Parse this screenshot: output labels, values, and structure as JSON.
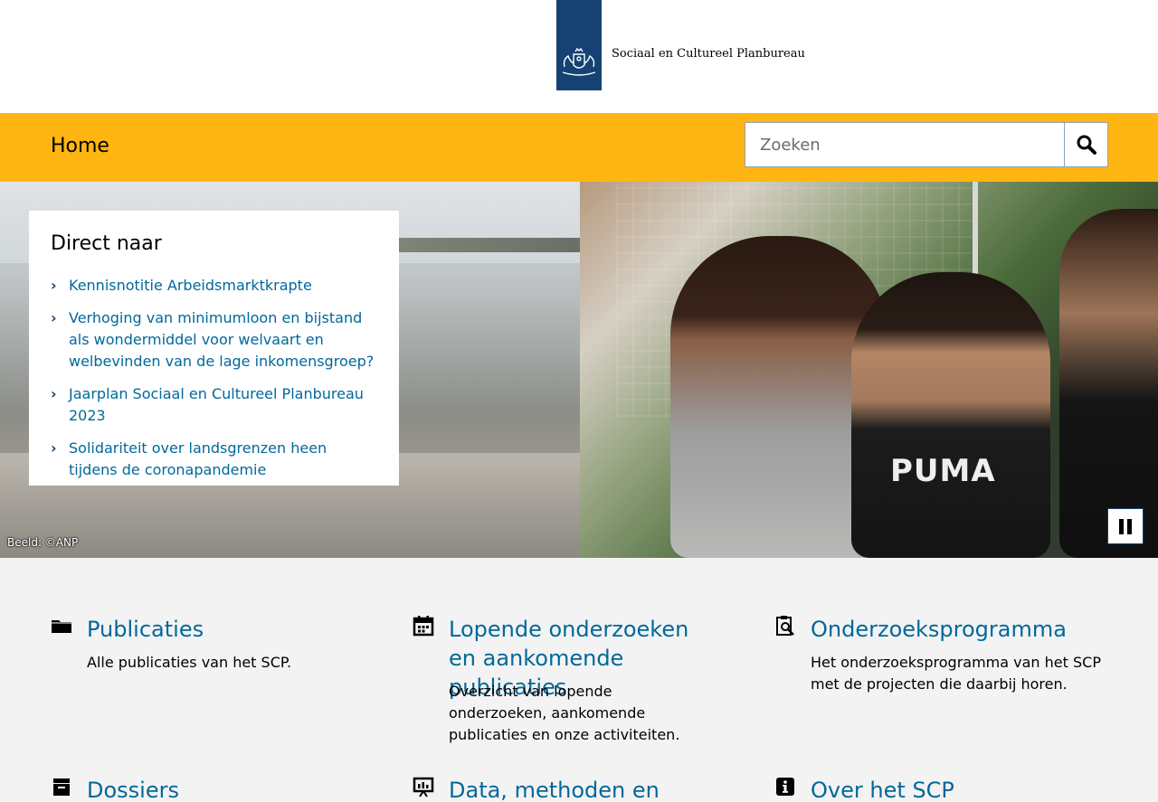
{
  "header": {
    "logo_text": "Sociaal en Cultureel Planbureau"
  },
  "nav": {
    "home_label": "Home",
    "search_placeholder": "Zoeken",
    "search_icon": "magnifier-icon"
  },
  "hero": {
    "direct_title": "Direct naar",
    "links": [
      {
        "label": "Kennisnotitie Arbeidsmarktkrapte"
      },
      {
        "label": "Verhoging van minimumloon en bijstand als wondermiddel voor welvaart en welbevinden van de lage inkomensgroep?"
      },
      {
        "label": "Jaarplan Sociaal en Cultureel Planbureau 2023"
      },
      {
        "label": "Solidariteit over landsgrenzen heen tijdens de coronapandemie"
      }
    ],
    "credit": "Beeld: ©ANP",
    "puma_text": "PUMA",
    "pause_icon": "pause-icon"
  },
  "tiles": [
    {
      "title": "Publicaties",
      "desc": "Alle publicaties van het SCP.",
      "icon": "folder-icon"
    },
    {
      "title": "Lopende onderzoeken en aankomende publicaties",
      "desc": "Overzicht van lopende onderzoeken, aankomende publicaties en onze activiteiten.",
      "icon": "calendar-icon"
    },
    {
      "title": "Onderzoeksprogramma",
      "desc": "Het onderzoeksprogramma van het SCP met de projecten die daarbij horen.",
      "icon": "clipboard-search-icon"
    },
    {
      "title": "Dossiers",
      "desc": "",
      "icon": "archive-box-icon"
    },
    {
      "title": "Data, methoden en",
      "desc": "",
      "icon": "presentation-screen-icon"
    },
    {
      "title": "Over het SCP",
      "desc": "",
      "icon": "info-icon"
    }
  ],
  "colors": {
    "brand_blue": "#154273",
    "link_blue": "#01689b",
    "nav_yellow": "#ffb612",
    "background": "#f3f3f3"
  }
}
